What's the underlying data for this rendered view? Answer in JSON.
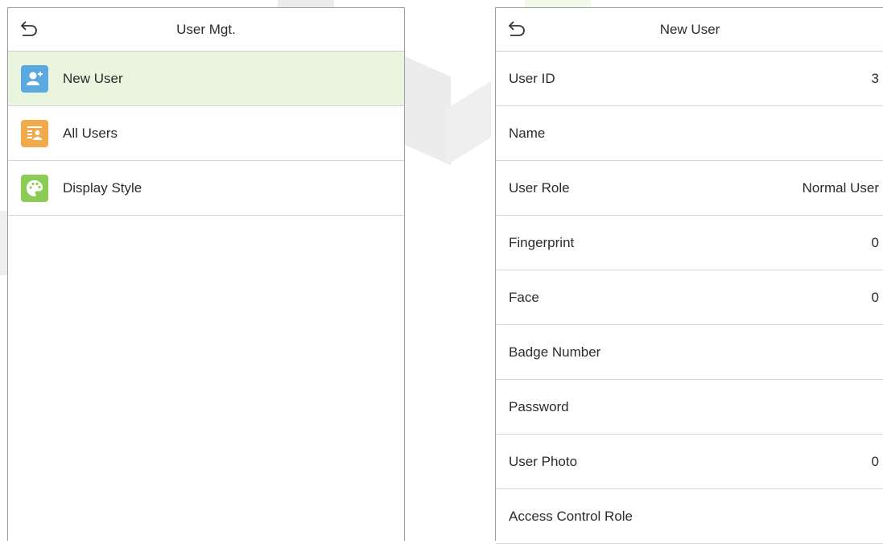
{
  "left": {
    "title": "User Mgt.",
    "items": [
      {
        "label": "New User",
        "icon": "new-user-icon",
        "color": "#5ba9e1"
      },
      {
        "label": "All Users",
        "icon": "all-users-icon",
        "color": "#f0a94b"
      },
      {
        "label": "Display Style",
        "icon": "display-style-icon",
        "color": "#8ccc55"
      }
    ],
    "selected_index": 0,
    "selected_bg": "#eaf5e0"
  },
  "right": {
    "title": "New User",
    "fields": [
      {
        "label": "User ID",
        "value": "3"
      },
      {
        "label": "Name",
        "value": ""
      },
      {
        "label": "User Role",
        "value": "Normal User"
      },
      {
        "label": "Fingerprint",
        "value": "0"
      },
      {
        "label": "Face",
        "value": "0"
      },
      {
        "label": "Badge Number",
        "value": ""
      },
      {
        "label": "Password",
        "value": ""
      },
      {
        "label": "User Photo",
        "value": "0"
      },
      {
        "label": "Access Control Role",
        "value": ""
      }
    ]
  }
}
